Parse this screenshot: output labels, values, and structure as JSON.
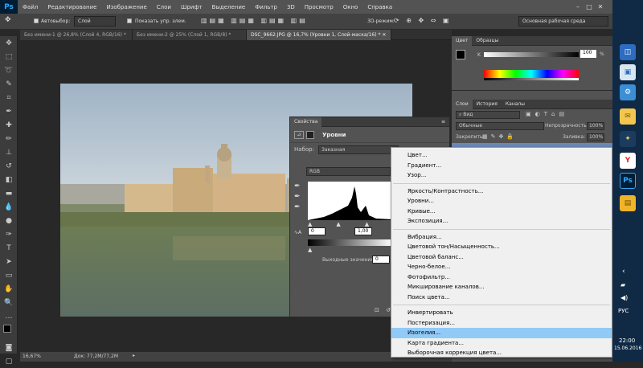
{
  "app": {
    "logo": "Ps"
  },
  "menu": [
    "Файл",
    "Редактирование",
    "Изображение",
    "Слои",
    "Шрифт",
    "Выделение",
    "Фильтр",
    "3D",
    "Просмотр",
    "Окно",
    "Справка"
  ],
  "options": {
    "autoselect_label": "Автовыбор:",
    "autoselect_value": "Слой",
    "show_controls_label": "Показать упр. элем.",
    "mode3d_label": "3D-режим:",
    "workspace": "Основная рабочая среда"
  },
  "tabs": [
    {
      "label": "Без имени-1 @ 26,8% (Слой 4, RGB/16) *"
    },
    {
      "label": "Без имени-2 @ 25% (Слой 1, RGB/8) *"
    },
    {
      "label": "DSC_9662.JPG @ 16,7% (Уровни 1, Слой-маска/16) *"
    }
  ],
  "status": {
    "zoom": "16,67%",
    "doc": "Док: 77,2M/77,2M"
  },
  "color_panel": {
    "tabs": [
      "Цвет",
      "Образцы"
    ],
    "k_label": "K",
    "k_value": "100",
    "k_unit": "%"
  },
  "layers_panel": {
    "tabs": [
      "Слои",
      "История",
      "Каналы"
    ],
    "filter": "Вид",
    "blend": "Обычные",
    "opacity_label": "Непрозрачность:",
    "opacity": "100%",
    "lock_label": "Закрепить:",
    "fill_label": "Заливка:",
    "fill": "100%"
  },
  "properties": {
    "title": "Свойства",
    "subtitle": "Уровни",
    "preset_label": "Набор:",
    "preset": "Заказная",
    "channel": "RGB",
    "input_black": "0",
    "input_gamma": "1,00",
    "output_label": "Выходные значения:",
    "output_black": "0"
  },
  "context_menu": {
    "group1": [
      "Цвет...",
      "Градиент...",
      "Узор..."
    ],
    "group2": [
      "Яркость/Контрастность...",
      "Уровни...",
      "Кривые...",
      "Экспозиция..."
    ],
    "group3": [
      "Вибрация...",
      "Цветовой тон/Насыщенность...",
      "Цветовой баланс...",
      "Черно-белое...",
      "Фотофильтр...",
      "Микширование каналов...",
      "Поиск цвета..."
    ],
    "group4": [
      "Инвертировать",
      "Постеризация...",
      "Изогелия...",
      "Карта градиента...",
      "Выборочная коррекция цвета..."
    ],
    "highlighted": "Изогелия..."
  },
  "taskbar": {
    "lang": "РУС",
    "time": "22:00",
    "date": "15.06.2016"
  }
}
